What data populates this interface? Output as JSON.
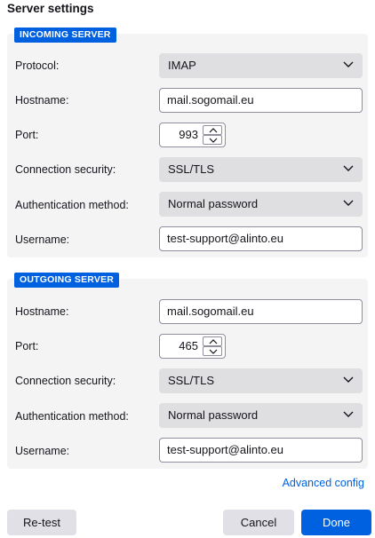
{
  "title": "Server settings",
  "incoming": {
    "heading": "INCOMING SERVER",
    "protocol_label": "Protocol:",
    "protocol_value": "IMAP",
    "hostname_label": "Hostname:",
    "hostname_value": "mail.sogomail.eu",
    "port_label": "Port:",
    "port_value": "993",
    "security_label": "Connection security:",
    "security_value": "SSL/TLS",
    "auth_label": "Authentication method:",
    "auth_value": "Normal password",
    "username_label": "Username:",
    "username_value": "test-support@alinto.eu"
  },
  "outgoing": {
    "heading": "OUTGOING SERVER",
    "hostname_label": "Hostname:",
    "hostname_value": "mail.sogomail.eu",
    "port_label": "Port:",
    "port_value": "465",
    "security_label": "Connection security:",
    "security_value": "SSL/TLS",
    "auth_label": "Authentication method:",
    "auth_value": "Normal password",
    "username_label": "Username:",
    "username_value": "test-support@alinto.eu"
  },
  "advanced_link": "Advanced config",
  "buttons": {
    "retest": "Re-test",
    "cancel": "Cancel",
    "done": "Done"
  },
  "colors": {
    "accent": "#0061e0",
    "section_bg": "#f4f4f5",
    "select_bg": "#dfdfe2"
  },
  "icons": {
    "dropdown": "chevron-down-icon",
    "spin_up": "chevron-up-icon",
    "spin_down": "chevron-down-icon"
  }
}
